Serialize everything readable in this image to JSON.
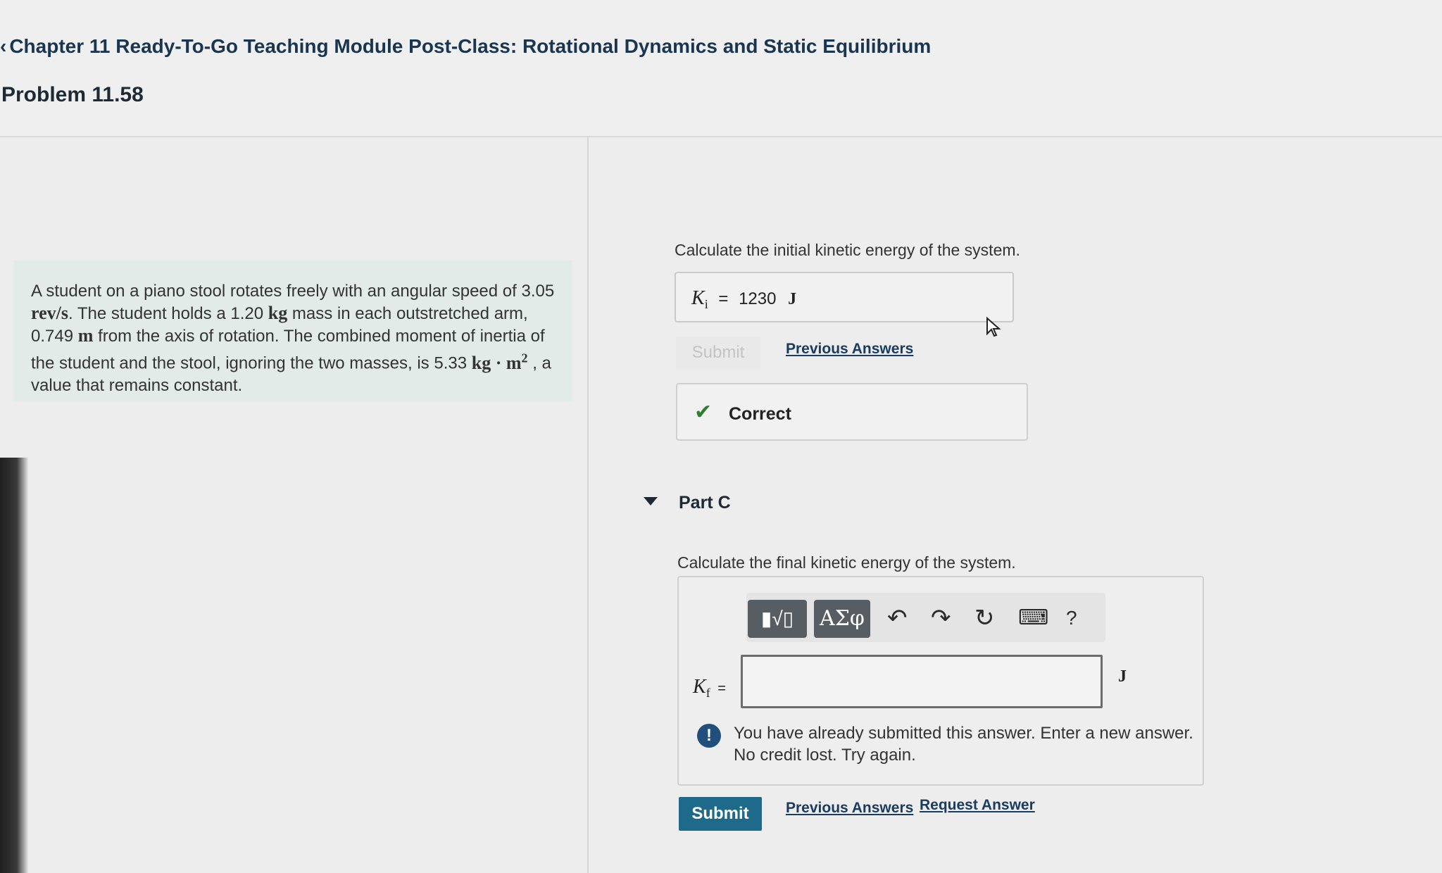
{
  "header": {
    "back_label": "Chapter 11 Ready-To-Go Teaching Module Post-Class: Rotational Dynamics and Static Equilibrium",
    "problem_title": "Problem 11.58"
  },
  "problem": {
    "text_1": "A student on a piano stool rotates freely with an angular speed of",
    "omega_value": "3.05",
    "omega_unit": "rev/s",
    "text_2": ". The student holds a",
    "mass_value": "1.20",
    "mass_unit": "kg",
    "text_3": "mass in each outstretched arm,",
    "dist_value": "0.749",
    "dist_unit": "m",
    "text_4": "from the axis of rotation. The combined moment of inertia of the student and the stool, ignoring the two masses, is",
    "inertia_value": "5.33",
    "inertia_unit": "kg · m",
    "inertia_exp": "2",
    "text_5": ", a value that remains constant."
  },
  "part_b": {
    "prompt": "Calculate the initial kinetic energy of the system.",
    "symbol": "K",
    "subscript": "i",
    "equals": "=",
    "value": "1230",
    "unit": "J",
    "submit_label": "Submit",
    "previous_answers_label": "Previous Answers",
    "feedback": "Correct"
  },
  "part_c": {
    "title": "Part C",
    "prompt": "Calculate the final kinetic energy of the system.",
    "toolbar": {
      "templates_label": "▮√▯",
      "greek_label": "ΑΣφ",
      "help_label": "?"
    },
    "symbol": "K",
    "subscript": "f",
    "equals": "=",
    "input_value": "",
    "unit": "J",
    "warning_line1": "You have already submitted this answer. Enter a new answer.",
    "warning_line2": "No credit lost. Try again.",
    "submit_label": "Submit",
    "previous_answers_label": "Previous Answers",
    "request_answer_label": "Request Answer"
  },
  "colors": {
    "accent": "#1d6a8a",
    "correct": "#2e7d32",
    "link": "#1a3c60"
  }
}
